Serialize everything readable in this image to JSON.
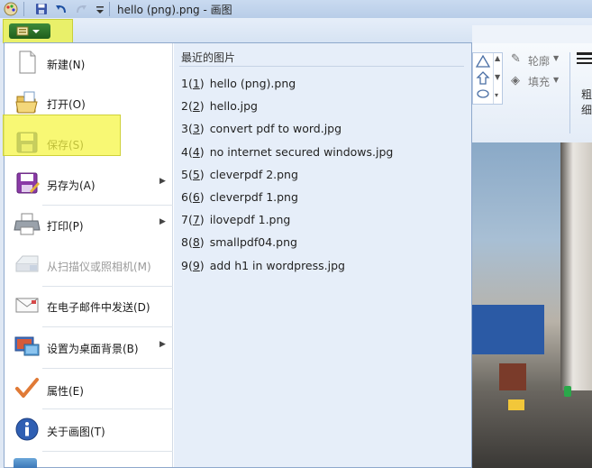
{
  "window": {
    "title": "hello (png).png - 画图"
  },
  "quick_access": {
    "save_icon": "save-icon",
    "undo_icon": "undo-icon",
    "redo_icon": "redo-icon",
    "customize_icon": "customize-icon"
  },
  "ribbon": {
    "outline_label": "轮廓",
    "fill_label": "填充",
    "size_label_1": "粗",
    "size_label_2": "细"
  },
  "menu": {
    "items": [
      {
        "label": "新建(N)",
        "icon": "new-document-icon",
        "enabled": true,
        "submenu": false
      },
      {
        "label": "打开(O)",
        "icon": "open-folder-icon",
        "enabled": true,
        "submenu": false
      },
      {
        "label": "保存(S)",
        "icon": "save-icon",
        "enabled": true,
        "submenu": false,
        "highlighted": true
      },
      {
        "label": "另存为(A)",
        "icon": "save-as-icon",
        "enabled": true,
        "submenu": true
      },
      {
        "label": "打印(P)",
        "icon": "printer-icon",
        "enabled": true,
        "submenu": true
      },
      {
        "label": "从扫描仪或照相机(M)",
        "icon": "scanner-icon",
        "enabled": false,
        "submenu": false
      },
      {
        "label": "在电子邮件中发送(D)",
        "icon": "email-icon",
        "enabled": true,
        "submenu": false
      },
      {
        "label": "设置为桌面背景(B)",
        "icon": "desktop-background-icon",
        "enabled": true,
        "submenu": true
      },
      {
        "label": "属性(E)",
        "icon": "properties-checkmark-icon",
        "enabled": true,
        "submenu": false
      },
      {
        "label": "关于画图(T)",
        "icon": "info-icon",
        "enabled": true,
        "submenu": false
      }
    ],
    "recent_title": "最近的图片",
    "recent": [
      {
        "num": "1",
        "key": "1",
        "name": "hello (png).png"
      },
      {
        "num": "2",
        "key": "2",
        "name": "hello.jpg"
      },
      {
        "num": "3",
        "key": "3",
        "name": "convert pdf to word.jpg"
      },
      {
        "num": "4",
        "key": "4",
        "name": "no internet secured windows.jpg"
      },
      {
        "num": "5",
        "key": "5",
        "name": "cleverpdf 2.png"
      },
      {
        "num": "6",
        "key": "6",
        "name": "cleverpdf 1.png"
      },
      {
        "num": "7",
        "key": "7",
        "name": "ilovepdf 1.png"
      },
      {
        "num": "8",
        "key": "8",
        "name": "smallpdf04.png"
      },
      {
        "num": "9",
        "key": "9",
        "name": "add h1 in wordpress.jpg"
      }
    ]
  },
  "colors": {
    "highlight": "#f6f646",
    "menu_right_bg": "#e6eef9",
    "paint_button": "#2e7a2b"
  }
}
